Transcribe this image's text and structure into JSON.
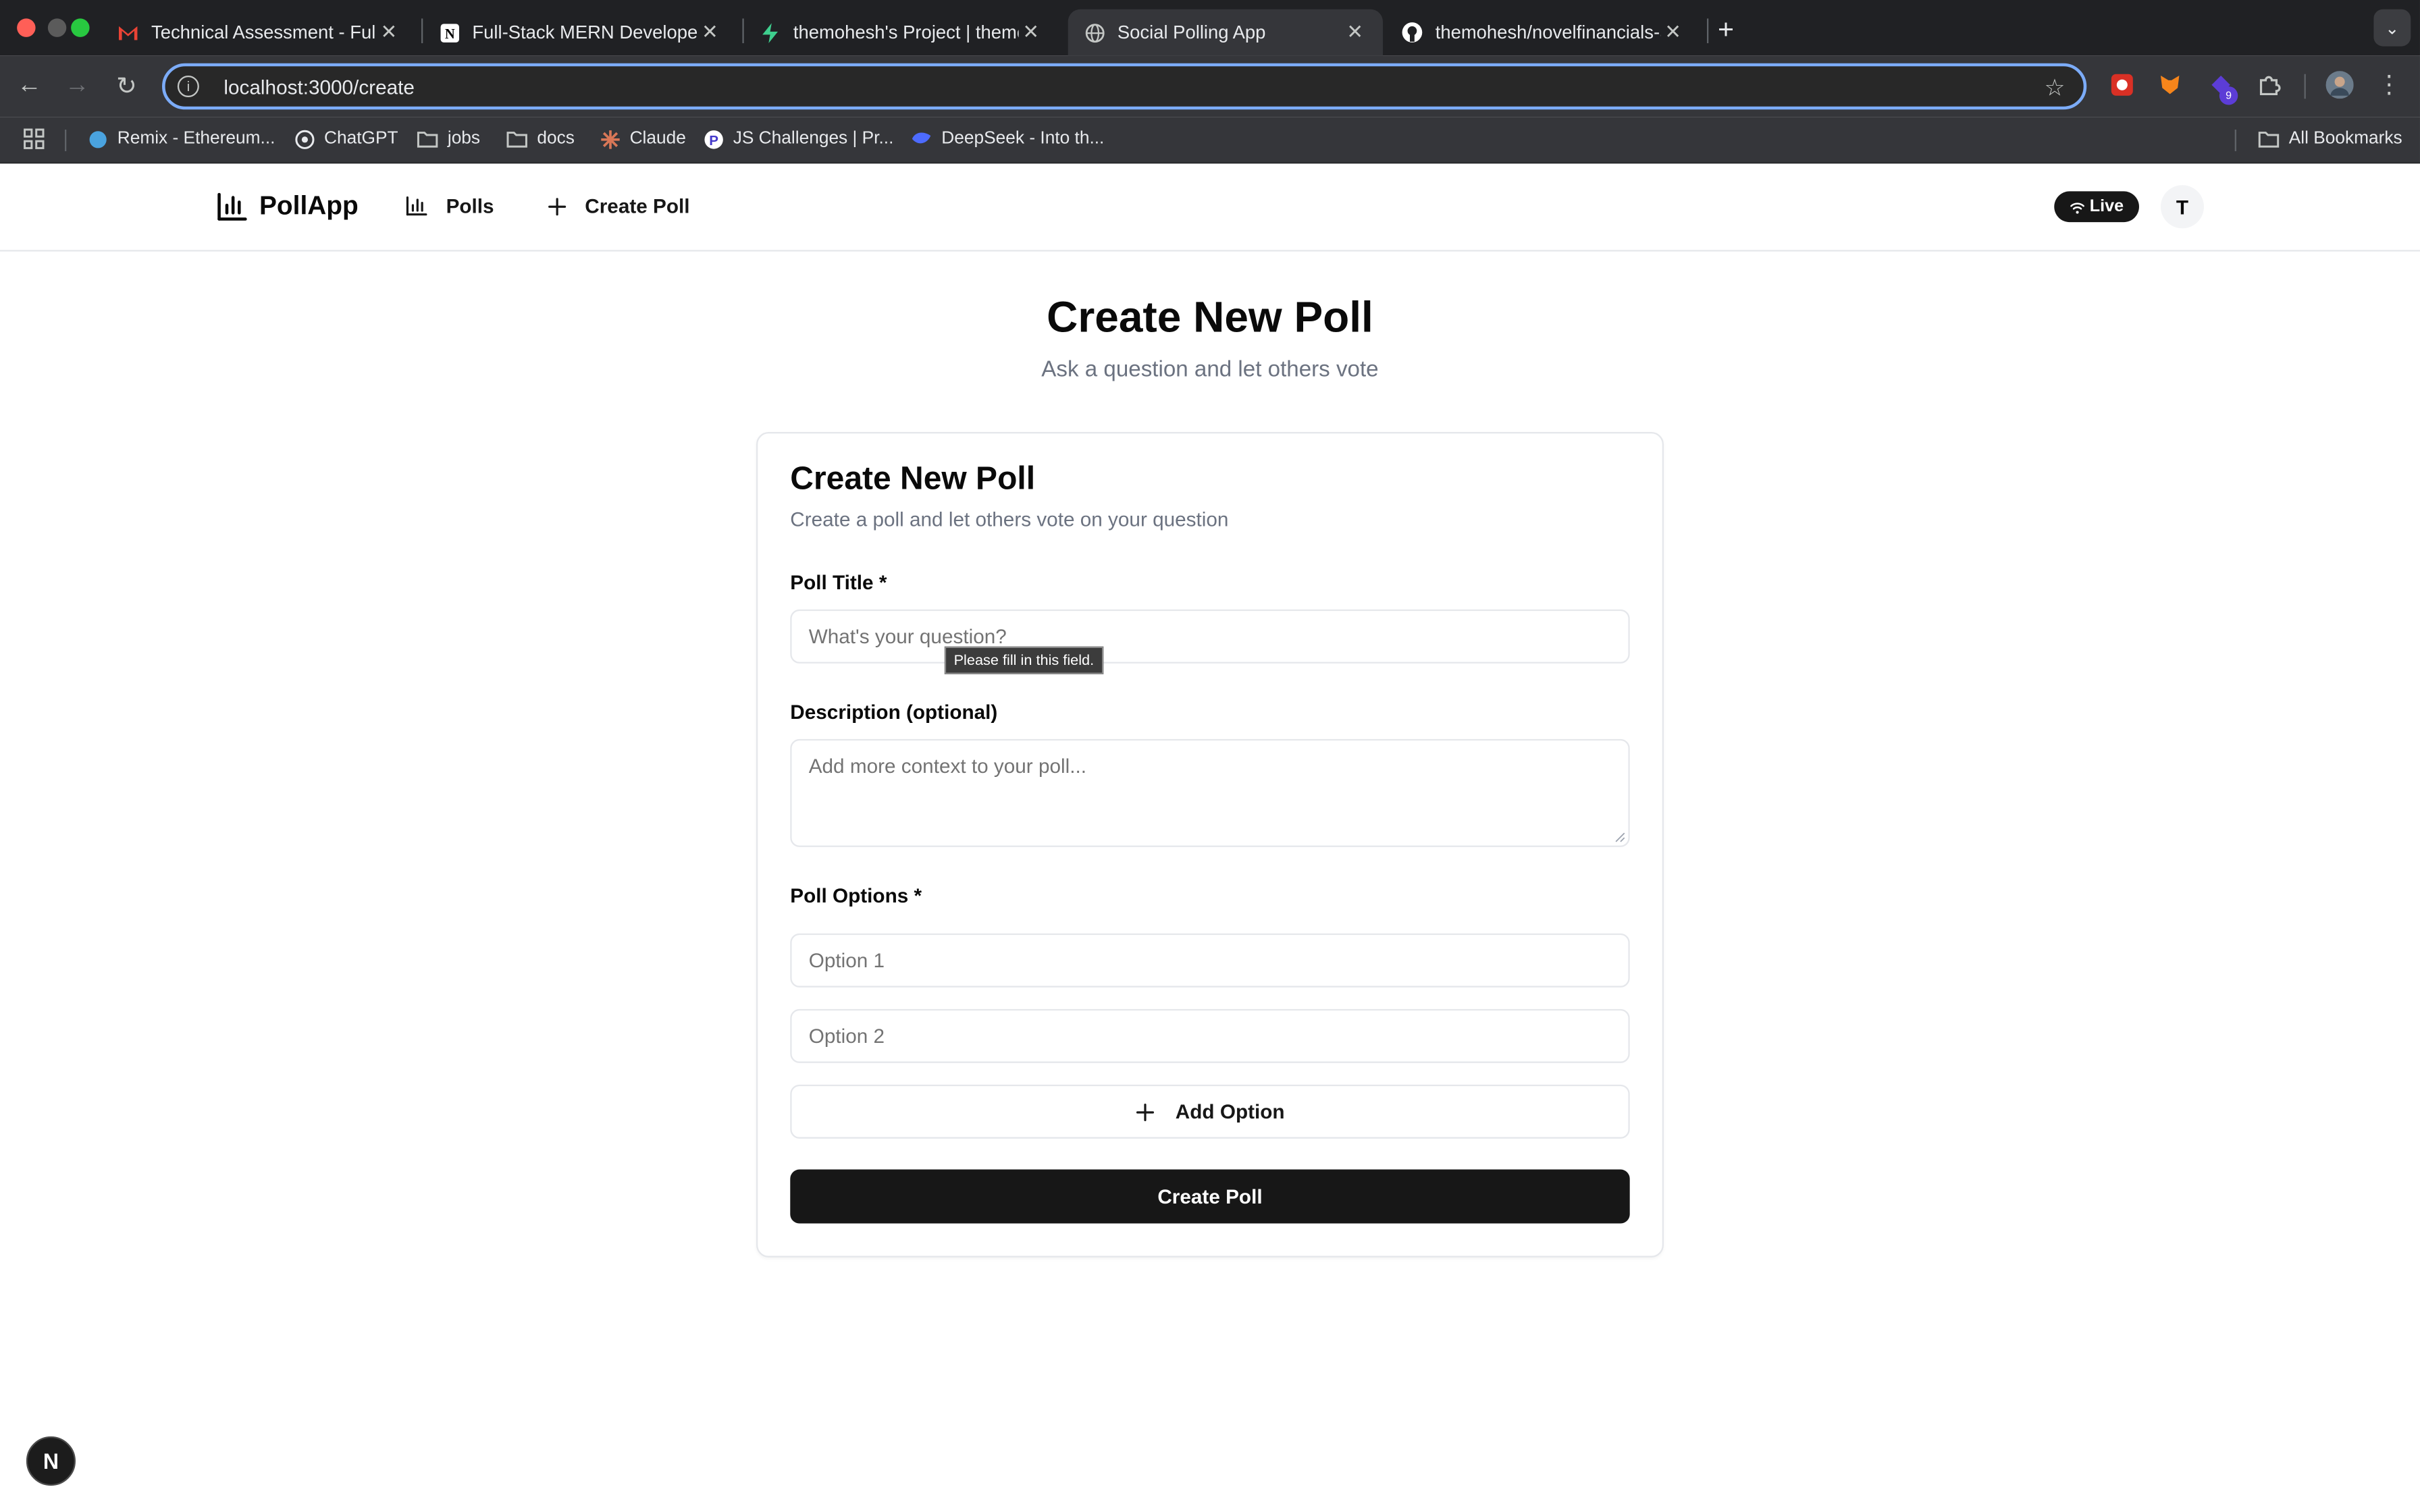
{
  "browser": {
    "tabs": [
      {
        "title": "Technical Assessment - Fullst",
        "icon": "gmail-icon"
      },
      {
        "title": "Full-Stack MERN Developer T",
        "icon": "notion-icon"
      },
      {
        "title": "themohesh's Project | themol",
        "icon": "supabase-icon"
      },
      {
        "title": "Social Polling App",
        "icon": "globe-icon"
      },
      {
        "title": "themohesh/novelfinancials-a",
        "icon": "github-icon"
      }
    ],
    "active_tab": 3,
    "url": "localhost:3000/create",
    "extensions_badge": "9",
    "bookmarks": [
      {
        "label": "Remix - Ethereum..."
      },
      {
        "label": "ChatGPT"
      },
      {
        "label": "jobs"
      },
      {
        "label": "docs"
      },
      {
        "label": "Claude"
      },
      {
        "label": "JS Challenges | Pr..."
      },
      {
        "label": "DeepSeek - Into th..."
      }
    ],
    "all_bookmarks": "All Bookmarks"
  },
  "app": {
    "brand": "PollApp",
    "nav": {
      "polls": "Polls",
      "create": "Create Poll"
    },
    "live_badge": "Live",
    "avatar_initial": "T"
  },
  "page": {
    "title": "Create New Poll",
    "subtitle": "Ask a question and let others vote"
  },
  "form": {
    "card_title": "Create New Poll",
    "card_description": "Create a poll and let others vote on your question",
    "title_label": "Poll Title *",
    "title_placeholder": "What's your question?",
    "validation_tooltip": "Please fill in this field.",
    "description_label": "Description (optional)",
    "description_placeholder": "Add more context to your poll...",
    "options_label": "Poll Options *",
    "option1_placeholder": "Option 1",
    "option2_placeholder": "Option 2",
    "add_option": "Add Option",
    "submit": "Create Poll"
  },
  "dev": {
    "next_badge": "N"
  },
  "colors": {
    "primary": "#171717",
    "chrome_dark": "#202124",
    "focus_ring": "#7cacf8"
  }
}
